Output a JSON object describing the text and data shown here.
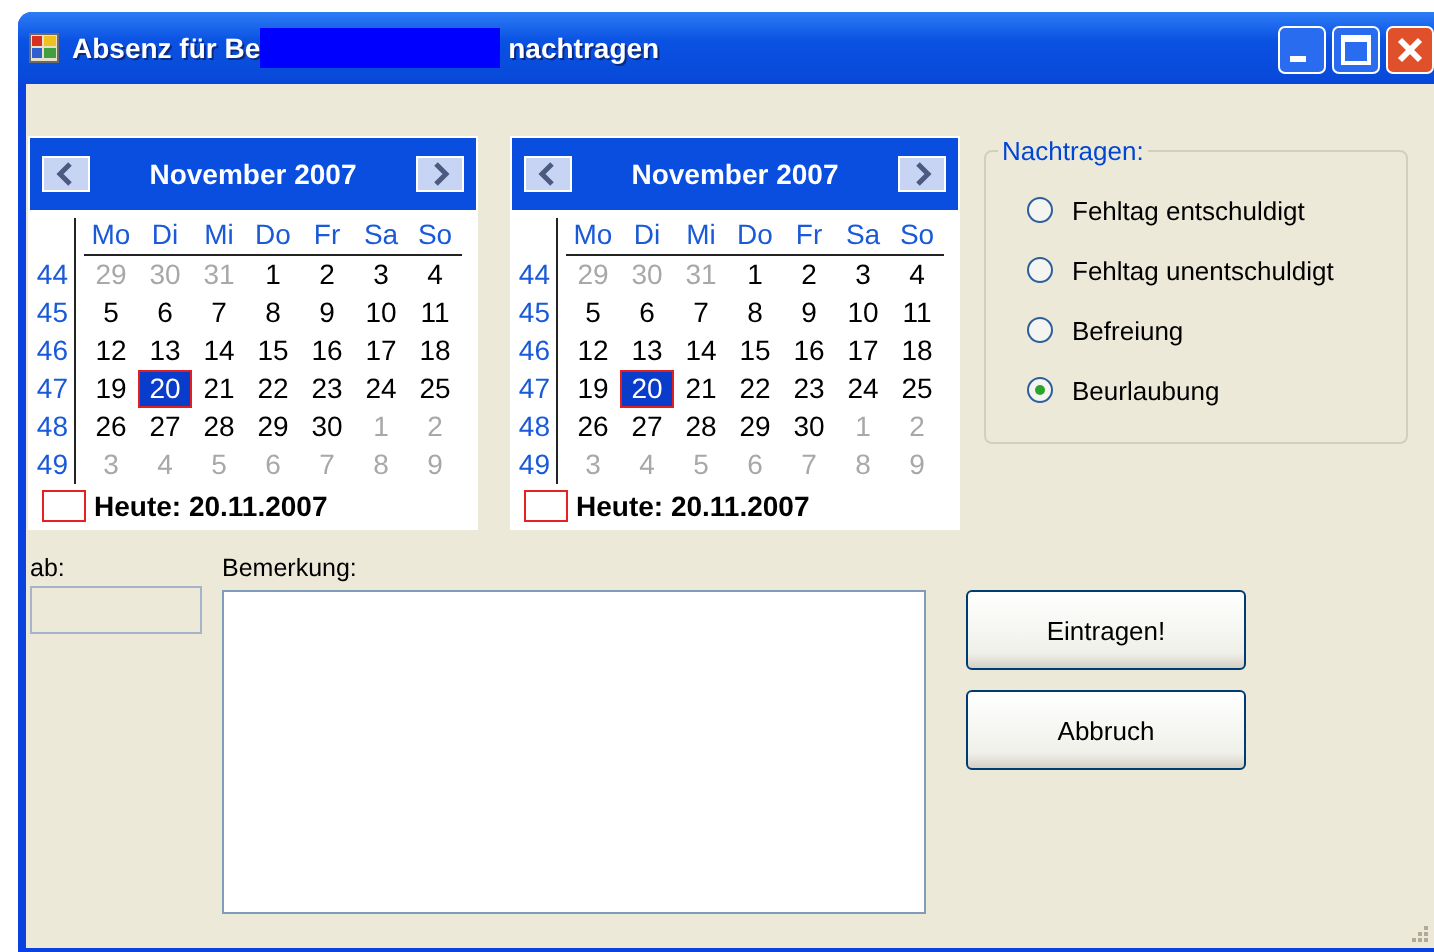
{
  "window": {
    "title_start": "Absenz für Be",
    "title_end": "nachtragen",
    "redacted": true
  },
  "calendars": [
    {
      "month": "November 2007",
      "day_names": [
        "Mo",
        "Di",
        "Mi",
        "Do",
        "Fr",
        "Sa",
        "So"
      ],
      "today": "Heute: 20.11.2007",
      "weeks": [
        {
          "week": "44",
          "days": [
            {
              "d": "29",
              "muted": true,
              "selected": false
            },
            {
              "d": "30",
              "muted": true,
              "selected": false
            },
            {
              "d": "31",
              "muted": true,
              "selected": false
            },
            {
              "d": "1",
              "muted": false,
              "selected": false
            },
            {
              "d": "2",
              "muted": false,
              "selected": false
            },
            {
              "d": "3",
              "muted": false,
              "selected": false
            },
            {
              "d": "4",
              "muted": false,
              "selected": false
            }
          ]
        },
        {
          "week": "45",
          "days": [
            {
              "d": "5",
              "muted": false,
              "selected": false
            },
            {
              "d": "6",
              "muted": false,
              "selected": false
            },
            {
              "d": "7",
              "muted": false,
              "selected": false
            },
            {
              "d": "8",
              "muted": false,
              "selected": false
            },
            {
              "d": "9",
              "muted": false,
              "selected": false
            },
            {
              "d": "10",
              "muted": false,
              "selected": false
            },
            {
              "d": "11",
              "muted": false,
              "selected": false
            }
          ]
        },
        {
          "week": "46",
          "days": [
            {
              "d": "12",
              "muted": false,
              "selected": false
            },
            {
              "d": "13",
              "muted": false,
              "selected": false
            },
            {
              "d": "14",
              "muted": false,
              "selected": false
            },
            {
              "d": "15",
              "muted": false,
              "selected": false
            },
            {
              "d": "16",
              "muted": false,
              "selected": false
            },
            {
              "d": "17",
              "muted": false,
              "selected": false
            },
            {
              "d": "18",
              "muted": false,
              "selected": false
            }
          ]
        },
        {
          "week": "47",
          "days": [
            {
              "d": "19",
              "muted": false,
              "selected": false
            },
            {
              "d": "20",
              "muted": false,
              "selected": true
            },
            {
              "d": "21",
              "muted": false,
              "selected": false
            },
            {
              "d": "22",
              "muted": false,
              "selected": false
            },
            {
              "d": "23",
              "muted": false,
              "selected": false
            },
            {
              "d": "24",
              "muted": false,
              "selected": false
            },
            {
              "d": "25",
              "muted": false,
              "selected": false
            }
          ]
        },
        {
          "week": "48",
          "days": [
            {
              "d": "26",
              "muted": false,
              "selected": false
            },
            {
              "d": "27",
              "muted": false,
              "selected": false
            },
            {
              "d": "28",
              "muted": false,
              "selected": false
            },
            {
              "d": "29",
              "muted": false,
              "selected": false
            },
            {
              "d": "30",
              "muted": false,
              "selected": false
            },
            {
              "d": "1",
              "muted": true,
              "selected": false
            },
            {
              "d": "2",
              "muted": true,
              "selected": false
            }
          ]
        },
        {
          "week": "49",
          "days": [
            {
              "d": "3",
              "muted": true,
              "selected": false
            },
            {
              "d": "4",
              "muted": true,
              "selected": false
            },
            {
              "d": "5",
              "muted": true,
              "selected": false
            },
            {
              "d": "6",
              "muted": true,
              "selected": false
            },
            {
              "d": "7",
              "muted": true,
              "selected": false
            },
            {
              "d": "8",
              "muted": true,
              "selected": false
            },
            {
              "d": "9",
              "muted": true,
              "selected": false
            }
          ]
        }
      ]
    },
    {
      "month": "November 2007",
      "day_names": [
        "Mo",
        "Di",
        "Mi",
        "Do",
        "Fr",
        "Sa",
        "So"
      ],
      "today": "Heute: 20.11.2007",
      "weeks": [
        {
          "week": "44",
          "days": [
            {
              "d": "29",
              "muted": true,
              "selected": false
            },
            {
              "d": "30",
              "muted": true,
              "selected": false
            },
            {
              "d": "31",
              "muted": true,
              "selected": false
            },
            {
              "d": "1",
              "muted": false,
              "selected": false
            },
            {
              "d": "2",
              "muted": false,
              "selected": false
            },
            {
              "d": "3",
              "muted": false,
              "selected": false
            },
            {
              "d": "4",
              "muted": false,
              "selected": false
            }
          ]
        },
        {
          "week": "45",
          "days": [
            {
              "d": "5",
              "muted": false,
              "selected": false
            },
            {
              "d": "6",
              "muted": false,
              "selected": false
            },
            {
              "d": "7",
              "muted": false,
              "selected": false
            },
            {
              "d": "8",
              "muted": false,
              "selected": false
            },
            {
              "d": "9",
              "muted": false,
              "selected": false
            },
            {
              "d": "10",
              "muted": false,
              "selected": false
            },
            {
              "d": "11",
              "muted": false,
              "selected": false
            }
          ]
        },
        {
          "week": "46",
          "days": [
            {
              "d": "12",
              "muted": false,
              "selected": false
            },
            {
              "d": "13",
              "muted": false,
              "selected": false
            },
            {
              "d": "14",
              "muted": false,
              "selected": false
            },
            {
              "d": "15",
              "muted": false,
              "selected": false
            },
            {
              "d": "16",
              "muted": false,
              "selected": false
            },
            {
              "d": "17",
              "muted": false,
              "selected": false
            },
            {
              "d": "18",
              "muted": false,
              "selected": false
            }
          ]
        },
        {
          "week": "47",
          "days": [
            {
              "d": "19",
              "muted": false,
              "selected": false
            },
            {
              "d": "20",
              "muted": false,
              "selected": true
            },
            {
              "d": "21",
              "muted": false,
              "selected": false
            },
            {
              "d": "22",
              "muted": false,
              "selected": false
            },
            {
              "d": "23",
              "muted": false,
              "selected": false
            },
            {
              "d": "24",
              "muted": false,
              "selected": false
            },
            {
              "d": "25",
              "muted": false,
              "selected": false
            }
          ]
        },
        {
          "week": "48",
          "days": [
            {
              "d": "26",
              "muted": false,
              "selected": false
            },
            {
              "d": "27",
              "muted": false,
              "selected": false
            },
            {
              "d": "28",
              "muted": false,
              "selected": false
            },
            {
              "d": "29",
              "muted": false,
              "selected": false
            },
            {
              "d": "30",
              "muted": false,
              "selected": false
            },
            {
              "d": "1",
              "muted": true,
              "selected": false
            },
            {
              "d": "2",
              "muted": true,
              "selected": false
            }
          ]
        },
        {
          "week": "49",
          "days": [
            {
              "d": "3",
              "muted": true,
              "selected": false
            },
            {
              "d": "4",
              "muted": true,
              "selected": false
            },
            {
              "d": "5",
              "muted": true,
              "selected": false
            },
            {
              "d": "6",
              "muted": true,
              "selected": false
            },
            {
              "d": "7",
              "muted": true,
              "selected": false
            },
            {
              "d": "8",
              "muted": true,
              "selected": false
            },
            {
              "d": "9",
              "muted": true,
              "selected": false
            }
          ]
        }
      ]
    }
  ],
  "group": {
    "legend": "Nachtragen:",
    "options": [
      {
        "label": "Fehltag entschuldigt",
        "selected": false
      },
      {
        "label": "Fehltag unentschuldigt",
        "selected": false
      },
      {
        "label": "Befreiung",
        "selected": false
      },
      {
        "label": "Beurlaubung",
        "selected": true
      }
    ]
  },
  "from": {
    "label": "ab:",
    "disabled": true
  },
  "remark": {
    "label": "Bemerkung:"
  },
  "buttons": [
    "Eintragen!",
    "Abbruch"
  ]
}
